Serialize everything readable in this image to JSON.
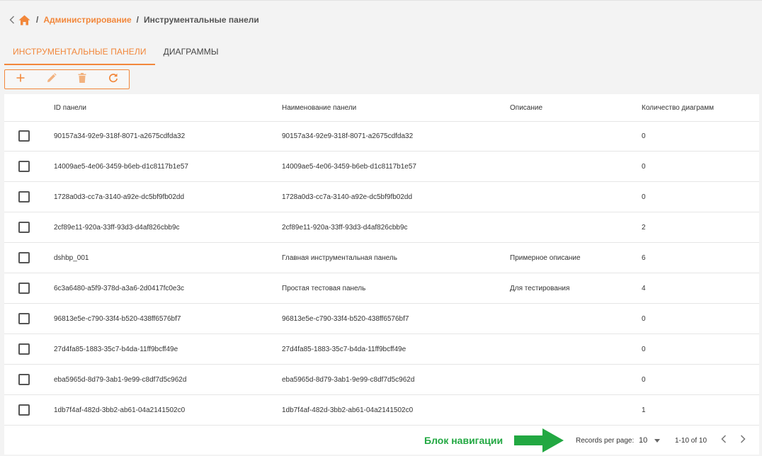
{
  "breadcrumb": {
    "admin_label": "Администрирование",
    "current_label": "Инструментальные панели",
    "separator": "/"
  },
  "tabs": [
    {
      "label": "ИНСТРУМЕНТАЛЬНЫЕ ПАНЕЛИ",
      "active": true
    },
    {
      "label": "ДИАГРАММЫ",
      "active": false
    }
  ],
  "toolbar": {
    "icons": [
      "plus-icon",
      "pencil-icon",
      "trash-icon",
      "refresh-icon"
    ]
  },
  "table": {
    "headers": {
      "id": "ID панели",
      "name": "Наименование панели",
      "description": "Описание",
      "count": "Количество диаграмм"
    },
    "rows": [
      {
        "id": "90157a34-92e9-318f-8071-a2675cdfda32",
        "name": "90157a34-92e9-318f-8071-a2675cdfda32",
        "description": "",
        "count": "0"
      },
      {
        "id": "14009ae5-4e06-3459-b6eb-d1c8117b1e57",
        "name": "14009ae5-4e06-3459-b6eb-d1c8117b1e57",
        "description": "",
        "count": "0"
      },
      {
        "id": "1728a0d3-cc7a-3140-a92e-dc5bf9fb02dd",
        "name": "1728a0d3-cc7a-3140-a92e-dc5bf9fb02dd",
        "description": "",
        "count": "0"
      },
      {
        "id": "2cf89e11-920a-33ff-93d3-d4af826cbb9c",
        "name": "2cf89e11-920a-33ff-93d3-d4af826cbb9c",
        "description": "",
        "count": "2"
      },
      {
        "id": "dshbp_001",
        "name": "Главная инструментальная панель",
        "description": "Примерное описание",
        "count": "6"
      },
      {
        "id": "6c3a6480-a5f9-378d-a3a6-2d0417fc0e3c",
        "name": "Простая тестовая панель",
        "description": "Для тестирования",
        "count": "4"
      },
      {
        "id": "96813e5e-c790-33f4-b520-438ff6576bf7",
        "name": "96813e5e-c790-33f4-b520-438ff6576bf7",
        "description": "",
        "count": "0"
      },
      {
        "id": "27d4fa85-1883-35c7-b4da-11ff9bcff49e",
        "name": "27d4fa85-1883-35c7-b4da-11ff9bcff49e",
        "description": "",
        "count": "0"
      },
      {
        "id": "eba5965d-8d79-3ab1-9e99-c8df7d5c962d",
        "name": "eba5965d-8d79-3ab1-9e99-c8df7d5c962d",
        "description": "",
        "count": "0"
      },
      {
        "id": "1db7f4af-482d-3bb2-ab61-04a2141502c0",
        "name": "1db7f4af-482d-3bb2-ab61-04a2141502c0",
        "description": "",
        "count": "1"
      }
    ]
  },
  "footer": {
    "nav_annotation": "Блок навигации",
    "records_per_page_label": "Records per page:",
    "records_per_page_value": "10",
    "range": "1-10 of 10"
  },
  "colors": {
    "accent": "#f2873b",
    "annotation": "#22a842"
  }
}
